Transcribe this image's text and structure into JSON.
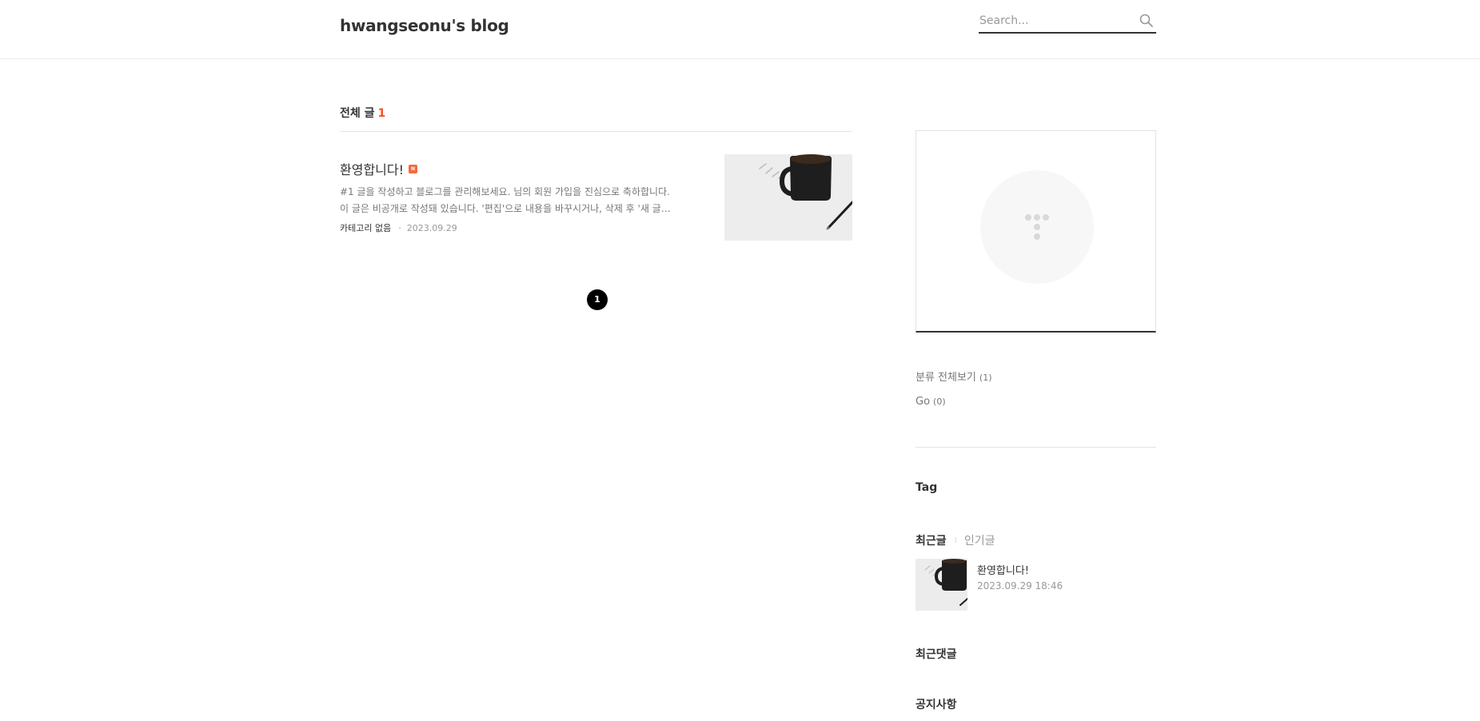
{
  "header": {
    "blog_title": "hwangseonu's blog",
    "search_placeholder": "Search..."
  },
  "main": {
    "list_label": "전체 글",
    "list_count": "1",
    "posts": [
      {
        "title": "환영합니다!",
        "new_badge": "N",
        "excerpt_line1": "#1 글을 작성하고 블로그를 관리해보세요. 님의 회원 가입을 진심으로 축하합니다.",
        "excerpt_line2": "이 글은 비공개로 작성돼 있습니다. '편집'으로 내용을 바꾸시거나, 삭제 후 '새 글…",
        "category": "카테고리 없음",
        "date": "2023.09.29"
      }
    ],
    "pagination": {
      "current": "1"
    }
  },
  "sidebar": {
    "categories": [
      {
        "label": "분류 전체보기",
        "count": "(1)"
      },
      {
        "label": "Go",
        "count": "(0)"
      }
    ],
    "tag_heading": "Tag",
    "tabs": {
      "recent": "최근글",
      "popular": "인기글"
    },
    "recent_posts": [
      {
        "title": "환영합니다!",
        "date": "2023.09.29 18:46"
      }
    ],
    "recent_comments_heading": "최근댓글",
    "notice_heading": "공지사항"
  },
  "colors": {
    "accent": "#fc4e1e",
    "new_badge": "#f26b3a",
    "text": "#333333",
    "muted": "#999999"
  },
  "icons": {
    "search": "search-icon",
    "new_badge": "new-badge-icon",
    "avatar": "tistory-logo-icon"
  }
}
